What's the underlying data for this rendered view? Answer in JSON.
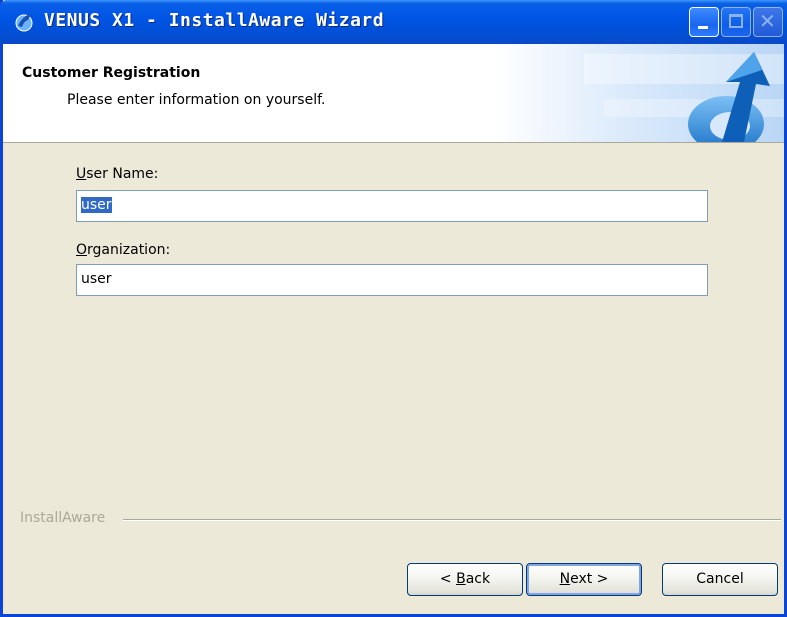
{
  "window": {
    "title": "VENUS X1 - InstallAware Wizard"
  },
  "header": {
    "title": "Customer Registration",
    "subtitle": "Please enter information on yourself."
  },
  "form": {
    "user_name": {
      "label_accel": "U",
      "label_rest": "ser Name:",
      "value": "user",
      "selected": true
    },
    "organization": {
      "label_accel": "O",
      "label_rest": "rganization:",
      "value": "user"
    }
  },
  "branding": {
    "text": "InstallAware"
  },
  "buttons": {
    "back": {
      "prefix": "< ",
      "accel": "B",
      "rest": "ack"
    },
    "next": {
      "accel": "N",
      "rest": "ext >"
    },
    "cancel": {
      "label": "Cancel"
    }
  },
  "icons": {
    "title": "installaware-logo-icon",
    "header": "installaware-arrow-icon",
    "minimize": "minimize-icon",
    "maximize": "maximize-icon",
    "close": "close-icon"
  },
  "colors": {
    "titlebar": "#0055e5",
    "dialog_bg": "#ece9d8",
    "selection": "#316ac5",
    "field_border": "#7f9db9"
  }
}
